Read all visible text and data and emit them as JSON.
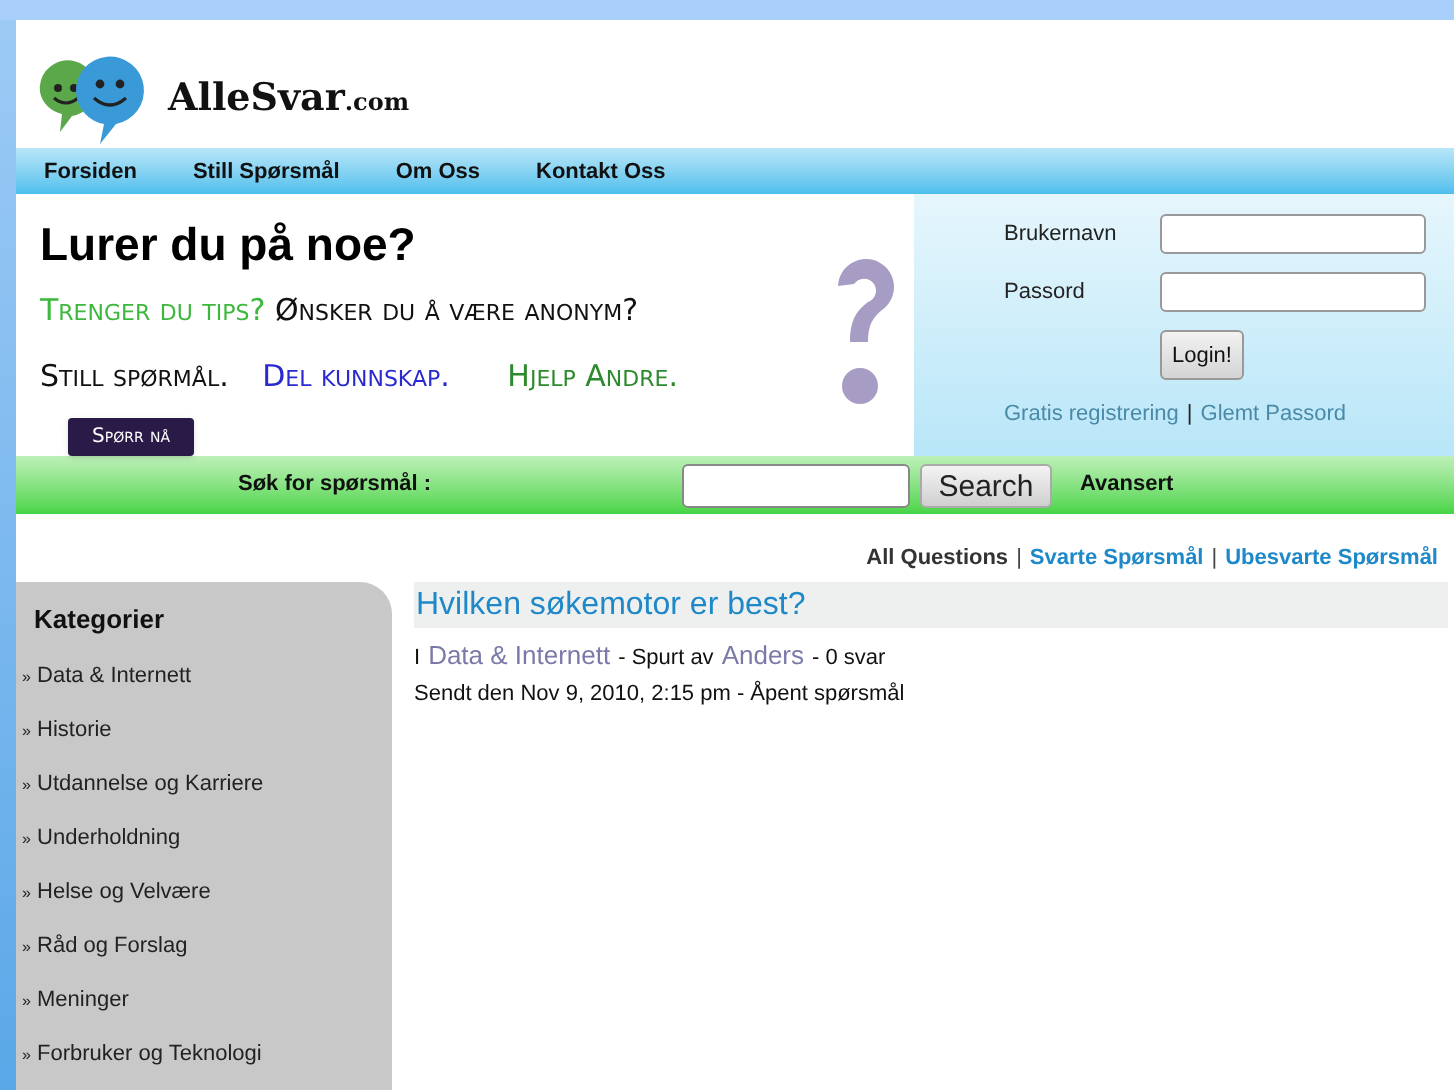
{
  "site": {
    "name": "AlleSvar",
    "suffix": ".com"
  },
  "nav": [
    "Forsiden",
    "Still Spørsmål",
    "Om Oss",
    "Kontakt Oss"
  ],
  "banner": {
    "headline": "Lurer du på noe?",
    "line_1a": "Trenger du tips?",
    "line_1b": "Ønsker du å være anonym?",
    "line_2a": "Still spørmål.",
    "line_2b": "Del kunnskap.",
    "line_2c": "Hjelp Andre.",
    "button": "Spørr nå"
  },
  "login": {
    "username_label": "Brukernavn",
    "password_label": "Passord",
    "button": "Login!",
    "register": "Gratis registrering",
    "separator": "|",
    "forgot": "Glemt Passord"
  },
  "search": {
    "label": "Søk for spørsmål :",
    "button": "Search",
    "advanced": "Avansert"
  },
  "filters": [
    {
      "label": "All Questions",
      "selected": true
    },
    {
      "label": "Svarte Spørsmål",
      "selected": false
    },
    {
      "label": "Ubesvarte Spørsmål",
      "selected": false
    }
  ],
  "sidebar": {
    "title": "Kategorier",
    "marker": "»",
    "items": [
      "Data & Internett",
      "Historie",
      "Utdannelse og Karriere",
      "Underholdning",
      "Helse og Velvære",
      "Råd og Forslag",
      "Meninger",
      "Forbruker og Teknologi"
    ]
  },
  "question": {
    "title": "Hvilken søkemotor er best?",
    "prefix": "I",
    "category": "Data & Internett",
    "asked_by": "- Spurt av",
    "author": "Anders",
    "answers": "- 0 svar",
    "posted": "Sendt den Nov 9, 2010, 2:15 pm - Åpent spørsmål"
  }
}
